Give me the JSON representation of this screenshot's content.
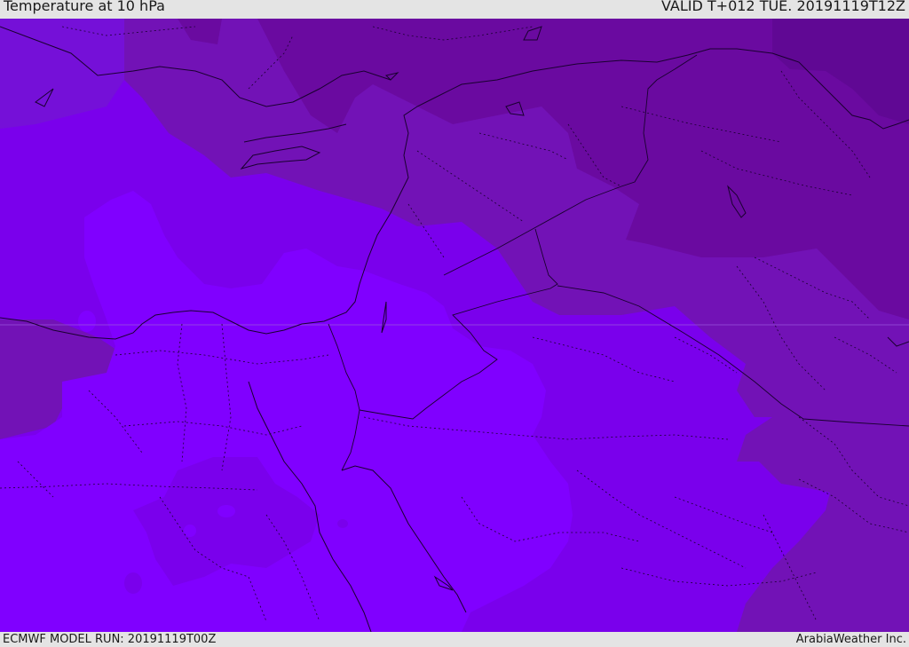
{
  "header": {
    "title": "Temperature at 10 hPa",
    "valid": "VALID T+012 TUE. 20191119T12Z"
  },
  "footer": {
    "model_run": "ECMWF MODEL RUN: 20191119T00Z",
    "credit": "ArabiaWeather Inc."
  },
  "map": {
    "field": "temperature",
    "level": "10 hPa",
    "palette": [
      "#8000ff",
      "#7a00ec",
      "#7510d8",
      "#7212b6",
      "#6a0aa0",
      "#600894"
    ]
  }
}
